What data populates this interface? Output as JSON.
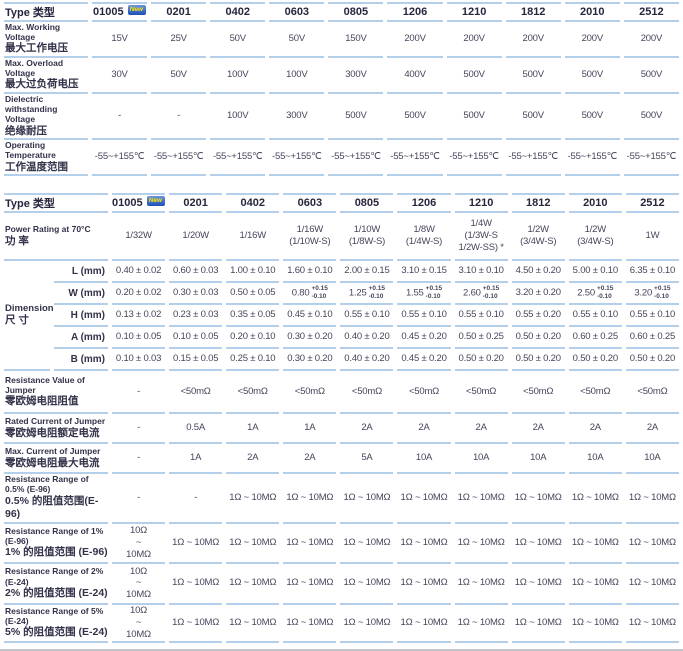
{
  "columns": [
    "01005",
    "0201",
    "0402",
    "0603",
    "0805",
    "1206",
    "1210",
    "1812",
    "2010",
    "2512"
  ],
  "new_badge_label": "New",
  "colors": {
    "table_line": "#b4cfe9",
    "badge_bg": "#1d4fb5",
    "badge_text": "#ffe600",
    "bottom_divider": "#c0c4ca"
  },
  "table1": {
    "type_label": "Type 类型",
    "rows": [
      {
        "label_en": [
          "Max. Working Voltage"
        ],
        "label_zh": "最大工作电压",
        "cells": [
          "15V",
          "25V",
          "50V",
          "50V",
          "150V",
          "200V",
          "200V",
          "200V",
          "200V",
          "200V"
        ]
      },
      {
        "label_en": [
          "Max. Overload Voltage"
        ],
        "label_zh": "最大过负荷电压",
        "cells": [
          "30V",
          "50V",
          "100V",
          "100V",
          "300V",
          "400V",
          "500V",
          "500V",
          "500V",
          "500V"
        ]
      },
      {
        "label_en": [
          "Dielectric withstanding",
          "Voltage"
        ],
        "label_zh": "绝缘耐压",
        "cells": [
          "-",
          "-",
          "100V",
          "300V",
          "500V",
          "500V",
          "500V",
          "500V",
          "500V",
          "500V"
        ]
      },
      {
        "label_en": [
          "Operating Temperature"
        ],
        "label_zh": "工作温度范围",
        "cells": [
          "-55~+155℃",
          "-55~+155℃",
          "-55~+155℃",
          "-55~+155℃",
          "-55~+155℃",
          "-55~+155℃",
          "-55~+155℃",
          "-55~+155℃",
          "-55~+155℃",
          "-55~+155℃"
        ]
      }
    ]
  },
  "table2": {
    "type_label": "Type 类型",
    "power_row": {
      "label_en": [
        "Power Rating at 70°C"
      ],
      "label_zh": "功 率",
      "cells": [
        "1/32W",
        "1/20W",
        "1/16W",
        {
          "lines": [
            "1/16W",
            "(1/10W-S)"
          ]
        },
        {
          "lines": [
            "1/10W",
            "(1/8W-S)"
          ]
        },
        {
          "lines": [
            "1/8W",
            "(1/4W-S)"
          ]
        },
        {
          "lines": [
            "1/4W",
            "(1/3W-S",
            "1/2W-SS) *"
          ]
        },
        {
          "lines": [
            "1/2W",
            "(3/4W-S)"
          ]
        },
        {
          "lines": [
            "1/2W",
            "(3/4W-S)"
          ]
        },
        "1W"
      ]
    },
    "dimension_group": {
      "label_en": "Dimension",
      "label_zh": "尺 寸"
    },
    "dimension_rows": [
      {
        "label": "L (mm)",
        "cells": [
          "0.40 ± 0.02",
          "0.60 ± 0.03",
          "1.00 ± 0.10",
          "1.60 ± 0.10",
          "2.00 ± 0.15",
          "3.10 ± 0.15",
          "3.10 ± 0.10",
          "4.50 ± 0.20",
          "5.00 ± 0.10",
          "6.35 ± 0.10"
        ]
      },
      {
        "label": "W (mm)",
        "cells": [
          "0.20 ± 0.02",
          "0.30 ± 0.03",
          "0.50 ± 0.05",
          {
            "v": "0.80",
            "plus": "+0.15",
            "minus": "-0.10"
          },
          {
            "v": "1.25",
            "plus": "+0.15",
            "minus": "-0.10"
          },
          {
            "v": "1.55",
            "plus": "+0.15",
            "minus": "-0.10"
          },
          {
            "v": "2.60",
            "plus": "+0.15",
            "minus": "-0.10"
          },
          "3.20 ± 0.20",
          {
            "v": "2.50",
            "plus": "+0.15",
            "minus": "-0.10"
          },
          {
            "v": "3.20",
            "plus": "+0.15",
            "minus": "-0.10"
          }
        ]
      },
      {
        "label": "H (mm)",
        "cells": [
          "0.13 ± 0.02",
          "0.23 ± 0.03",
          "0.35 ± 0.05",
          "0.45 ± 0.10",
          "0.55 ± 0.10",
          "0.55 ± 0.10",
          "0.55 ± 0.10",
          "0.55 ± 0.20",
          "0.55 ± 0.10",
          "0.55 ± 0.10"
        ]
      },
      {
        "label": "A (mm)",
        "cells": [
          "0.10 ± 0.05",
          "0.10 ± 0.05",
          "0.20 ± 0.10",
          "0.30 ± 0.20",
          "0.40 ± 0.20",
          "0.45 ± 0.20",
          "0.50 ± 0.25",
          "0.50 ± 0.20",
          "0.60 ± 0.25",
          "0.60 ± 0.25"
        ]
      },
      {
        "label": "B (mm)",
        "cells": [
          "0.10 ± 0.03",
          "0.15 ± 0.05",
          "0.25 ± 0.10",
          "0.30 ± 0.20",
          "0.40 ± 0.20",
          "0.45 ± 0.20",
          "0.50 ± 0.20",
          "0.50 ± 0.20",
          "0.50 ± 0.20",
          "0.50 ± 0.20"
        ]
      }
    ],
    "spec_rows": [
      {
        "label_en": [
          "Resistance Value of",
          "Jumper"
        ],
        "label_zh": "零欧姆电阻阻值",
        "cells": [
          "-",
          "<50mΩ",
          "<50mΩ",
          "<50mΩ",
          "<50mΩ",
          "<50mΩ",
          "<50mΩ",
          "<50mΩ",
          "<50mΩ",
          "<50mΩ"
        ]
      },
      {
        "label_en": [
          "Rated Current of Jumper"
        ],
        "label_zh": "零欧姆电阻额定电流",
        "cells": [
          "-",
          "0.5A",
          "1A",
          "1A",
          "2A",
          "2A",
          "2A",
          "2A",
          "2A",
          "2A"
        ]
      },
      {
        "label_en": [
          "Max. Current of Jumper"
        ],
        "label_zh": "零欧姆电阻最大电流",
        "cells": [
          "-",
          "1A",
          "2A",
          "2A",
          "5A",
          "10A",
          "10A",
          "10A",
          "10A",
          "10A"
        ]
      },
      {
        "label_en": [
          "Resistance Range of",
          "0.5% (E-96)"
        ],
        "label_zh": "0.5% 的阻值范围(E-96)",
        "cells": [
          "-",
          "-",
          "1Ω ~ 10MΩ",
          "1Ω ~ 10MΩ",
          "1Ω ~ 10MΩ",
          "1Ω ~ 10MΩ",
          "1Ω ~ 10MΩ",
          "1Ω ~ 10MΩ",
          "1Ω ~ 10MΩ",
          "1Ω ~ 10MΩ"
        ]
      },
      {
        "label_en": [
          "Resistance Range of 1%",
          "(E-96)"
        ],
        "label_zh": "1% 的阻值范围 (E-96)",
        "cells": [
          {
            "lines": [
              "10Ω",
              "~",
              "10MΩ"
            ]
          },
          "1Ω ~ 10MΩ",
          "1Ω ~ 10MΩ",
          "1Ω ~ 10MΩ",
          "1Ω ~ 10MΩ",
          "1Ω ~ 10MΩ",
          "1Ω ~ 10MΩ",
          "1Ω ~ 10MΩ",
          "1Ω ~ 10MΩ",
          "1Ω ~ 10MΩ"
        ]
      },
      {
        "label_en": [
          "Resistance Range of 2%",
          "(E-24)"
        ],
        "label_zh": "2% 的阻值范围 (E-24)",
        "cells": [
          {
            "lines": [
              "10Ω",
              "~",
              "10MΩ"
            ]
          },
          "1Ω ~ 10MΩ",
          "1Ω ~ 10MΩ",
          "1Ω ~ 10MΩ",
          "1Ω ~ 10MΩ",
          "1Ω ~ 10MΩ",
          "1Ω ~ 10MΩ",
          "1Ω ~ 10MΩ",
          "1Ω ~ 10MΩ",
          "1Ω ~ 10MΩ"
        ]
      },
      {
        "label_en": [
          "Resistance Range of 5%",
          "(E-24)"
        ],
        "label_zh": "5% 的阻值范围 (E-24)",
        "cells": [
          {
            "lines": [
              "10Ω",
              "~",
              "10MΩ"
            ]
          },
          "1Ω ~ 10MΩ",
          "1Ω ~ 10MΩ",
          "1Ω ~ 10MΩ",
          "1Ω ~ 10MΩ",
          "1Ω ~ 10MΩ",
          "1Ω ~ 10MΩ",
          "1Ω ~ 10MΩ",
          "1Ω ~ 10MΩ",
          "1Ω ~ 10MΩ"
        ]
      }
    ]
  }
}
